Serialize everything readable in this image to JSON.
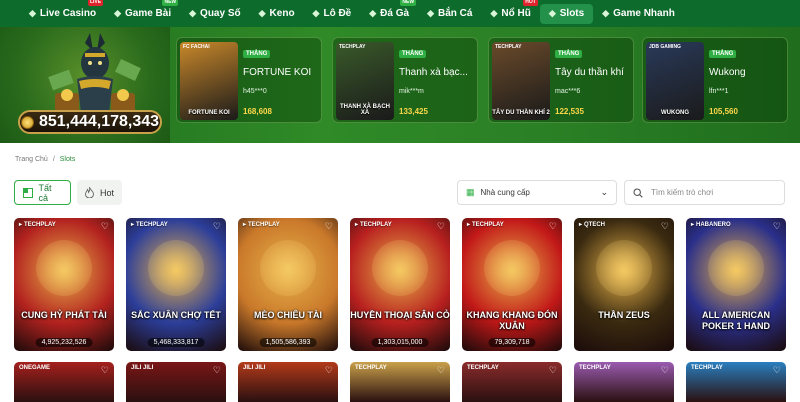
{
  "nav": {
    "items": [
      {
        "label": "Live Casino",
        "icon": "casino-chip-icon",
        "badge": "LIVE"
      },
      {
        "label": "Game Bài",
        "icon": "cards-icon",
        "badge": "NEW"
      },
      {
        "label": "Quay Số",
        "icon": "lottery-icon",
        "badge": ""
      },
      {
        "label": "Keno",
        "icon": "keno-icon",
        "badge": ""
      },
      {
        "label": "Lô Đề",
        "icon": "numbers-icon",
        "badge": ""
      },
      {
        "label": "Đá Gà",
        "icon": "rooster-icon",
        "badge": "NEW"
      },
      {
        "label": "Bắn Cá",
        "icon": "fish-icon",
        "badge": ""
      },
      {
        "label": "Nổ Hũ",
        "icon": "jar-icon",
        "badge": "HOT"
      },
      {
        "label": "Slots",
        "icon": "slots-icon",
        "badge": ""
      },
      {
        "label": "Game Nhanh",
        "icon": "rocket-icon",
        "badge": ""
      }
    ],
    "active": "Slots",
    "bg_color": "#0d6b2c"
  },
  "banner": {
    "jackpot": "851,444,178,343",
    "winners": [
      {
        "provider": "FC FACHAI",
        "thumb_caption": "FORTUNE KOI",
        "tag": "THẮNG",
        "game": "FORTUNE KOI",
        "user": "h45***0",
        "amount": "168,608"
      },
      {
        "provider": "TECHPLAY",
        "thumb_caption": "THANH XÀ BẠCH XÀ",
        "tag": "THẮNG",
        "game": "Thanh xà bạc...",
        "user": "mik***m",
        "amount": "133,425"
      },
      {
        "provider": "TECHPLAY",
        "thumb_caption": "TÂY DU THẦN KHÍ 2",
        "tag": "THẮNG",
        "game": "Tây du thần khí",
        "user": "mac***6",
        "amount": "122,535"
      },
      {
        "provider": "JDB GAMING",
        "thumb_caption": "WUKONG",
        "tag": "THẮNG",
        "game": "Wukong",
        "user": "lfn***1",
        "amount": "105,560"
      }
    ]
  },
  "breadcrumb": {
    "home": "Trang Chủ",
    "sep": "/",
    "current": "Slots"
  },
  "filters": {
    "all": "Tất cả",
    "hot": "Hot"
  },
  "provider_select": {
    "label": "Nhà cung cấp"
  },
  "search": {
    "placeholder": "Tìm kiếm trò chơi"
  },
  "games": [
    {
      "provider": "TECHPLAY",
      "title": "CUNG HỶ PHÁT TÀI",
      "amount": "4,925,232,526",
      "color": "#b3221f"
    },
    {
      "provider": "TECHPLAY",
      "title": "SẮC XUÂN CHỢ TẾT",
      "amount": "5,468,333,817",
      "color": "#2c3e9a"
    },
    {
      "provider": "TECHPLAY",
      "title": "MÈO CHIÊU TÀI",
      "amount": "1,505,586,393",
      "color": "#c9782a"
    },
    {
      "provider": "TECHPLAY",
      "title": "HUYỀN THOẠI SÂN CỎ",
      "amount": "1,303,015,000",
      "color": "#b8201f"
    },
    {
      "provider": "TECHPLAY",
      "title": "KHANG KHANG ĐÓN XUÂN",
      "amount": "79,309,718",
      "color": "#c21818"
    },
    {
      "provider": "QTECH",
      "title": "THẦN ZEUS",
      "amount": "",
      "color": "#3a2a10"
    },
    {
      "provider": "HABANERO",
      "title": "ALL AMERICAN POKER 1 HAND",
      "amount": "",
      "color": "#2a2f8a"
    }
  ],
  "games_row2": [
    {
      "provider": "ONEGAME",
      "color": "#a5201d"
    },
    {
      "provider": "JILI JILI",
      "color": "#7a1616"
    },
    {
      "provider": "JILI JILI",
      "color": "#b33a1a"
    },
    {
      "provider": "TECHPLAY",
      "color": "#c9a04a"
    },
    {
      "provider": "TECHPLAY",
      "color": "#8a2b2b"
    },
    {
      "provider": "TECHPLAY",
      "color": "#9a5bb0"
    },
    {
      "provider": "TECHPLAY",
      "color": "#2a7fc0"
    }
  ]
}
